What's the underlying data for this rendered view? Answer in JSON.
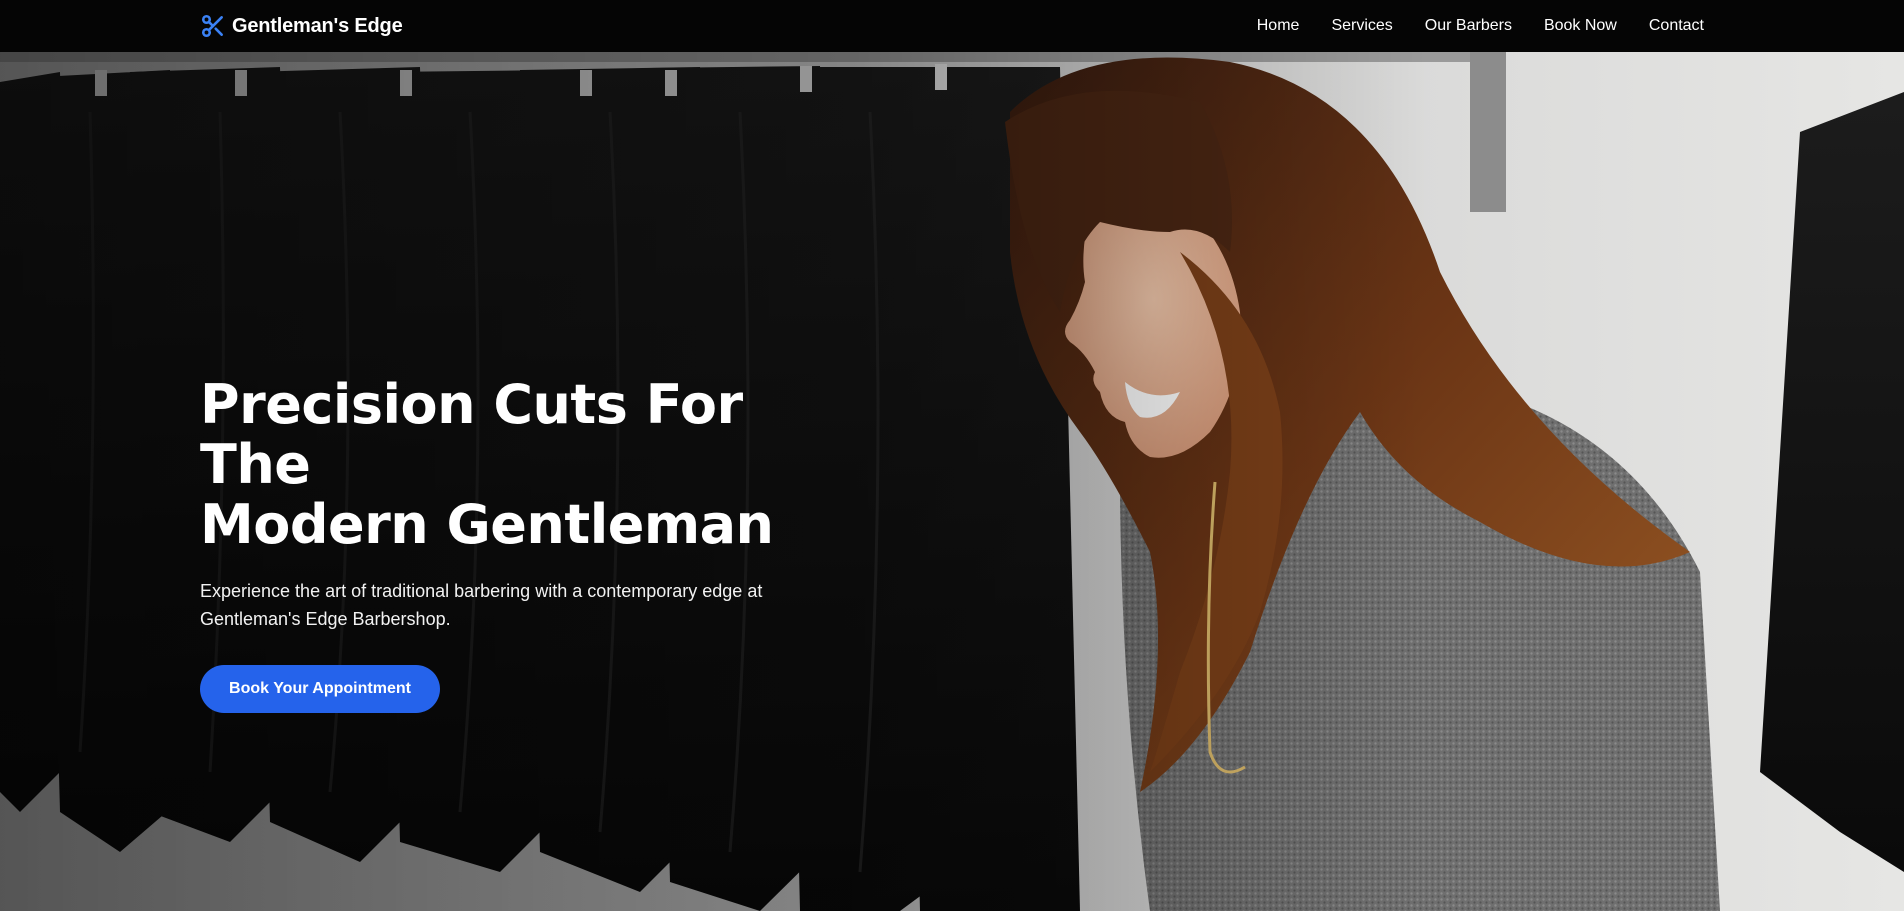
{
  "brand": {
    "name": "Gentleman's Edge",
    "icon": "scissors-icon",
    "accent": "#3b82f6"
  },
  "nav": {
    "items": [
      {
        "label": "Home"
      },
      {
        "label": "Services"
      },
      {
        "label": "Our Barbers"
      },
      {
        "label": "Book Now"
      },
      {
        "label": "Contact"
      }
    ]
  },
  "hero": {
    "title_line1": "Precision Cuts For The",
    "title_line2": "Modern Gentleman",
    "subtitle": "Experience the art of traditional barbering with a contemporary edge at Gentleman's Edge Barbershop.",
    "cta_label": "Book Your Appointment",
    "cta_color": "#2563eb",
    "image": "photo of smiling woman with long brown hair in grey sweater, black towels hanging on rack behind"
  }
}
